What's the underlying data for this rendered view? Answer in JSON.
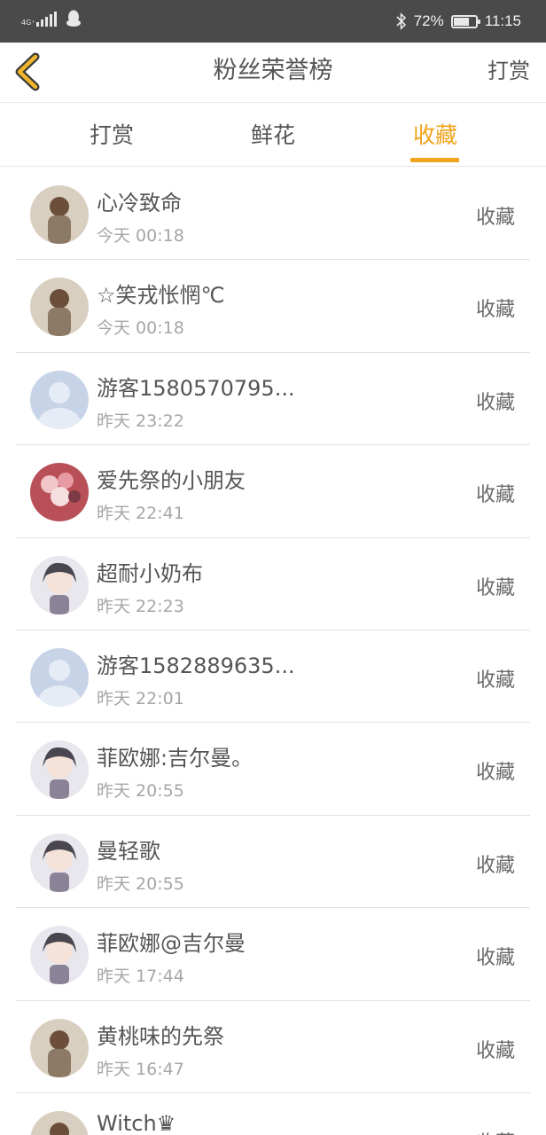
{
  "status_bar": {
    "network": "4G⁺",
    "battery_percent": "72%",
    "battery_level": 0.72,
    "time": "11:15",
    "icons": [
      "signal-icon",
      "qq-icon",
      "bluetooth-icon",
      "battery-icon"
    ]
  },
  "nav": {
    "title": "粉丝荣誉榜",
    "right_action": "打赏",
    "accent_color": "#f0a31c"
  },
  "tabs": [
    {
      "label": "打赏",
      "active": false
    },
    {
      "label": "鲜花",
      "active": false
    },
    {
      "label": "收藏",
      "active": true
    }
  ],
  "fans": [
    {
      "name": "心冷致命",
      "time": "今天 00:18",
      "action": "收藏",
      "avatar": "photo-avatar"
    },
    {
      "name": "☆笑戎怅惘℃",
      "time": "今天 00:18",
      "action": "收藏",
      "avatar": "photo-avatar"
    },
    {
      "name": "游客1580570795...",
      "time": "昨天 23:22",
      "action": "收藏",
      "avatar": "default-avatar"
    },
    {
      "name": "爱先祭的小朋友",
      "time": "昨天 22:41",
      "action": "收藏",
      "avatar": "flower-avatar"
    },
    {
      "name": "超耐小奶布",
      "time": "昨天 22:23",
      "action": "收藏",
      "avatar": "anime-avatar"
    },
    {
      "name": "游客1582889635...",
      "time": "昨天 22:01",
      "action": "收藏",
      "avatar": "default-avatar"
    },
    {
      "name": "菲欧娜:吉尔曼。",
      "time": "昨天 20:55",
      "action": "收藏",
      "avatar": "anime-avatar"
    },
    {
      "name": "曼轻歌",
      "time": "昨天 20:55",
      "action": "收藏",
      "avatar": "anime-avatar"
    },
    {
      "name": "菲欧娜@吉尔曼",
      "time": "昨天 17:44",
      "action": "收藏",
      "avatar": "anime-avatar"
    },
    {
      "name": "黄桃味的先祭",
      "time": "昨天 16:47",
      "action": "收藏",
      "avatar": "photo-avatar"
    },
    {
      "name": "Witch♛",
      "time": "",
      "action": "收藏",
      "avatar": "photo-avatar"
    }
  ]
}
